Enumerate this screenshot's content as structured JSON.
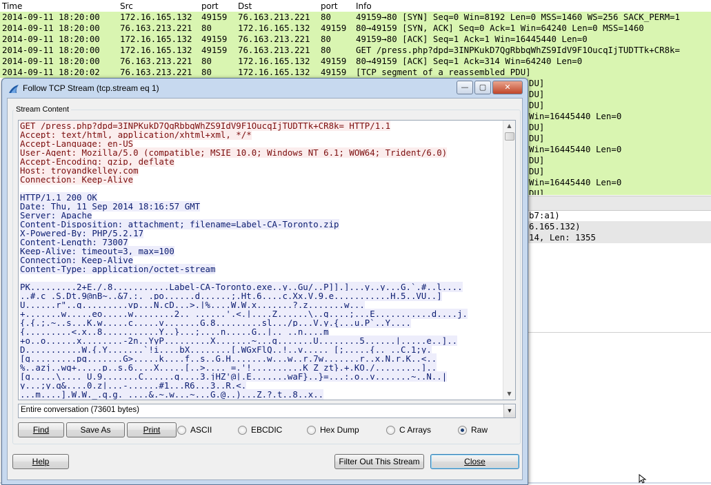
{
  "packet_list": {
    "columns": {
      "time": "Time",
      "src": "Src",
      "src_port": "port",
      "dst": "Dst",
      "dst_port": "port",
      "info": "Info"
    },
    "rows": [
      {
        "time": "2014-09-11 18:20:00",
        "src": "172.16.165.132",
        "sport": "49159",
        "dst": "76.163.213.221",
        "dport": "80",
        "info": "49159→80 [SYN] Seq=0 Win=8192 Len=0 MSS=1460 WS=256 SACK_PERM=1"
      },
      {
        "time": "2014-09-11 18:20:00",
        "src": "76.163.213.221",
        "sport": "80",
        "dst": "172.16.165.132",
        "dport": "49159",
        "info": "80→49159 [SYN, ACK] Seq=0 Ack=1 Win=64240 Len=0 MSS=1460"
      },
      {
        "time": "2014-09-11 18:20:00",
        "src": "172.16.165.132",
        "sport": "49159",
        "dst": "76.163.213.221",
        "dport": "80",
        "info": "49159→80 [ACK] Seq=1 Ack=1 Win=16445440 Len=0"
      },
      {
        "time": "2014-09-11 18:20:00",
        "src": "172.16.165.132",
        "sport": "49159",
        "dst": "76.163.213.221",
        "dport": "80",
        "info": "GET /press.php?dpd=3INPKukD7QgRbbqWhZS9IdV9F1OucqIjTUDTTk+CR8k="
      },
      {
        "time": "2014-09-11 18:20:00",
        "src": "76.163.213.221",
        "sport": "80",
        "dst": "172.16.165.132",
        "dport": "49159",
        "info": "80→49159 [ACK] Seq=1 Ack=314 Win=64240 Len=0"
      },
      {
        "time": "2014-09-11 18:20:02",
        "src": "76.163.213.221",
        "sport": "80",
        "dst": "172.16.165.132",
        "dport": "49159",
        "info": "[TCP segment of a reassembled PDU]"
      }
    ],
    "visible_right": [
      "DU]",
      "DU]",
      "DU]",
      " Win=16445440 Len=0",
      "DU]",
      "DU]",
      " Win=16445440 Len=0",
      "DU]",
      "DU]",
      " Win=16445440 Len=0",
      "DU]",
      "DU]",
      " Win=16445440 Len=0"
    ],
    "detail_right": [
      "b7:a1)",
      "6.165.132)",
      "14, Len: 1355"
    ]
  },
  "dialog": {
    "title": "Follow TCP Stream (tcp.stream eq 1)",
    "group_label": "Stream Content",
    "request_lines": [
      "GET /press.php?dpd=3INPKukD7QgRbbqWhZS9IdV9F1OucqIjTUDTTk+CR8k= HTTP/1.1",
      "Accept: text/html, application/xhtml+xml, */*",
      "Accept-Language: en-US",
      "User-Agent: Mozilla/5.0 (compatible; MSIE 10.0; Windows NT 6.1; WOW64; Trident/6.0)",
      "Accept-Encoding: gzip, deflate",
      "Host: troyandkelley.com",
      "Connection: Keep-Alive"
    ],
    "response_lines": [
      "HTTP/1.1 200 OK",
      "Date: Thu, 11 Sep 2014 18:16:57 GMT",
      "Server: Apache",
      "Content-Disposition: attachment; filename=Label-CA-Toronto.zip",
      "X-Powered-By: PHP/5.2.17",
      "Content-Length: 73007",
      "Keep-Alive: timeout=3, max=100",
      "Connection: Keep-Alive",
      "Content-Type: application/octet-stream"
    ],
    "binary_lines": [
      "PK.........2+E./.8...........Label-CA-Toronto.exe..y..Gu/..P]].]...y..y...G.`.#..l....",
      "..#.c .S.Dt.9@nB~..&7.:._.po......d......;.Ht.6....c.Xx.V.9.e...........H.5..VU..]",
      "U......r\"..q.........vp...N.cD...>.|%....W.W.x.......?.z.......w...",
      "+.......w.....eo.....w........2.._......'.<.|....Z......\\..g....;...E...........d....j.",
      "{.{.;.~..s...K.w.....c.....v.......G.8.........sl.../p...V.y.{...u.P`..Y....",
      "{.........<.x..8...........Y..}...;....n.....G..|.._..n....m",
      "+o..o......x........-2n..YyP.........X.......~...g.......U........5......|.....e..]..",
      "D...........W.{.Y.......`!i....bX........[.WGxFlQ..!..v....._[;.....{.._..C.1;y.",
      "[g.........pq.......G>.....k....f..s..G.H.......w...w..r.7w.......r..x.N.r.K..<..",
      "%..azj..wq+.....p..s.6....X.....[..>...._=.'!..........K_Z_zt}.+.KO./.........]..",
      "[g.....\\.... U.9.......C......q....3.jHZ'@|.E.......waF}..}=...:.o..v.......~..N..|",
      "y...;y.q&....0.z|...-......#1...R6...3..R.<.",
      "...m....].W.W._.q.g. ....&.~.w...~...G.@..)...Z.?.t..8..x.."
    ],
    "conversation_select": "Entire conversation (73601 bytes)",
    "buttons": {
      "find": "Find",
      "save_as": "Save As",
      "print": "Print",
      "help": "Help",
      "filter_out": "Filter Out This Stream",
      "close": "Close"
    },
    "radios": [
      {
        "label": "ASCII",
        "selected": false
      },
      {
        "label": "EBCDIC",
        "selected": false
      },
      {
        "label": "Hex Dump",
        "selected": false
      },
      {
        "label": "C Arrays",
        "selected": false
      },
      {
        "label": "Raw",
        "selected": true
      }
    ],
    "window_controls": {
      "minimize": "—",
      "maximize": "▢",
      "close": "✕"
    },
    "colors": {
      "client_text": "#7b0d0d",
      "client_bg": "#fbeded",
      "server_text": "#0b1c70",
      "server_bg": "#ededfb",
      "packet_bg": "#d9f5b1"
    }
  }
}
